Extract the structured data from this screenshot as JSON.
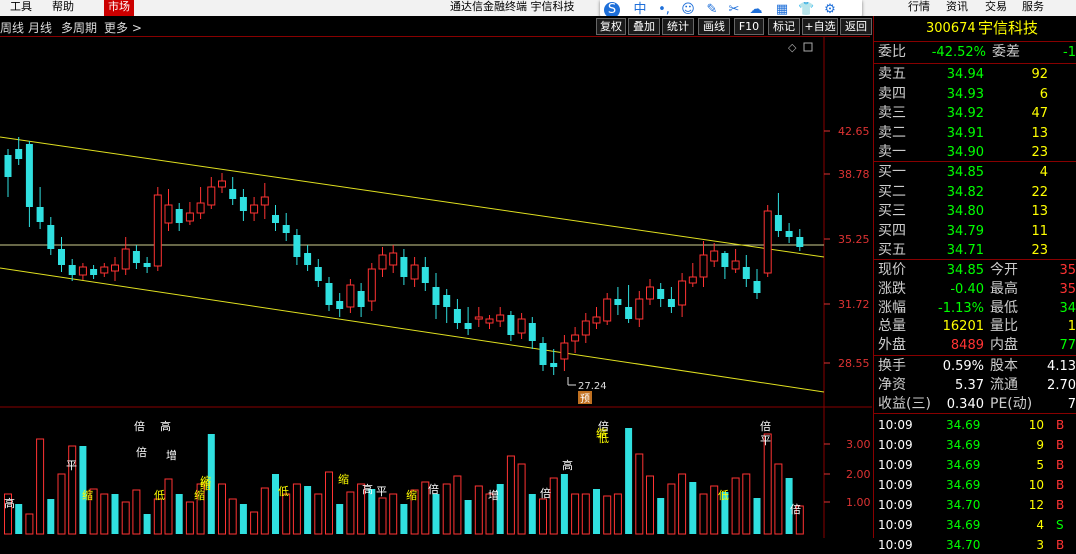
{
  "menu": {
    "items": [
      "工具",
      "帮助",
      "市场"
    ],
    "active": "市场",
    "title": "通达信金融终端 宇信科技",
    "right": [
      "行情",
      "资讯",
      "交易",
      "服务"
    ]
  },
  "iconbar": {
    "first": "中",
    "icons": [
      "smile-icon",
      "pen-icon",
      "scissors-icon",
      "cloud-icon",
      "shirt-icon",
      "gear-icon"
    ]
  },
  "periodbar": {
    "left": [
      "周线",
      "月线",
      "多周期",
      "更多 >"
    ],
    "tools": [
      "复权",
      "叠加",
      "统计",
      "画线",
      "F10",
      "标记",
      "+自选",
      "返回"
    ]
  },
  "chart_data": {
    "type": "candlestick",
    "yticks": [
      "42.65",
      "38.78",
      "35.25",
      "31.72",
      "28.55"
    ],
    "low_label": "27.24",
    "badge": "预",
    "vol_ticks": [
      "3.00",
      "2.00",
      "1.00"
    ],
    "vol_marks": [
      "倍",
      "高",
      "平",
      "缩",
      "倍",
      "增",
      "缩",
      "低",
      "低",
      "缩",
      "倍",
      "低",
      "缩",
      "平",
      "缩",
      "倍",
      "增",
      "倍",
      "高",
      "缩",
      "高",
      "倍",
      "平",
      "低",
      "倍",
      "高",
      "缩"
    ],
    "colors": {
      "up": "#ff3333",
      "down": "#30e0e0",
      "trend": "#e0e020"
    }
  },
  "panel": {
    "code": "300674",
    "name": "宇信科技",
    "weibi": {
      "label": "委比",
      "value": "-42.52%",
      "label2": "委差",
      "value2": "-1"
    },
    "sells": [
      {
        "label": "卖五",
        "price": "34.94",
        "vol": "92"
      },
      {
        "label": "卖四",
        "price": "34.93",
        "vol": "6"
      },
      {
        "label": "卖三",
        "price": "34.92",
        "vol": "47"
      },
      {
        "label": "卖二",
        "price": "34.91",
        "vol": "13"
      },
      {
        "label": "卖一",
        "price": "34.90",
        "vol": "23"
      }
    ],
    "buys": [
      {
        "label": "买一",
        "price": "34.85",
        "vol": "4"
      },
      {
        "label": "买二",
        "price": "34.82",
        "vol": "22"
      },
      {
        "label": "买三",
        "price": "34.80",
        "vol": "13"
      },
      {
        "label": "买四",
        "price": "34.79",
        "vol": "11"
      },
      {
        "label": "买五",
        "price": "34.71",
        "vol": "23"
      }
    ],
    "stats": [
      {
        "l1": "现价",
        "v1": "34.85",
        "c1": "green",
        "l2": "今开",
        "v2": "35",
        "c2": "red"
      },
      {
        "l1": "涨跌",
        "v1": "-0.40",
        "c1": "green",
        "l2": "最高",
        "v2": "35",
        "c2": "red"
      },
      {
        "l1": "涨幅",
        "v1": "-1.13%",
        "c1": "green",
        "l2": "最低",
        "v2": "34",
        "c2": "green"
      },
      {
        "l1": "总量",
        "v1": "16201",
        "c1": "yellow",
        "l2": "量比",
        "v2": "1",
        "c2": "yellow"
      },
      {
        "l1": "外盘",
        "v1": "8489",
        "c1": "red",
        "l2": "内盘",
        "v2": "77",
        "c2": "green"
      }
    ],
    "stats2": [
      {
        "l1": "换手",
        "v1": "0.59%",
        "l2": "股本",
        "v2": "4.13"
      },
      {
        "l1": "净资",
        "v1": "5.37",
        "l2": "流通",
        "v2": "2.70"
      },
      {
        "l1": "收益(三)",
        "v1": "0.340",
        "l2": "PE(动)",
        "v2": "7"
      }
    ],
    "ticks": [
      {
        "time": "10:09",
        "price": "34.69",
        "vol": "10",
        "side": "B"
      },
      {
        "time": "10:09",
        "price": "34.69",
        "vol": "9",
        "side": "B"
      },
      {
        "time": "10:09",
        "price": "34.69",
        "vol": "5",
        "side": "B"
      },
      {
        "time": "10:09",
        "price": "34.69",
        "vol": "10",
        "side": "B"
      },
      {
        "time": "10:09",
        "price": "34.70",
        "vol": "12",
        "side": "B"
      },
      {
        "time": "10:09",
        "price": "34.69",
        "vol": "4",
        "side": "S"
      },
      {
        "time": "10:09",
        "price": "34.70",
        "vol": "3",
        "side": "B"
      }
    ]
  }
}
